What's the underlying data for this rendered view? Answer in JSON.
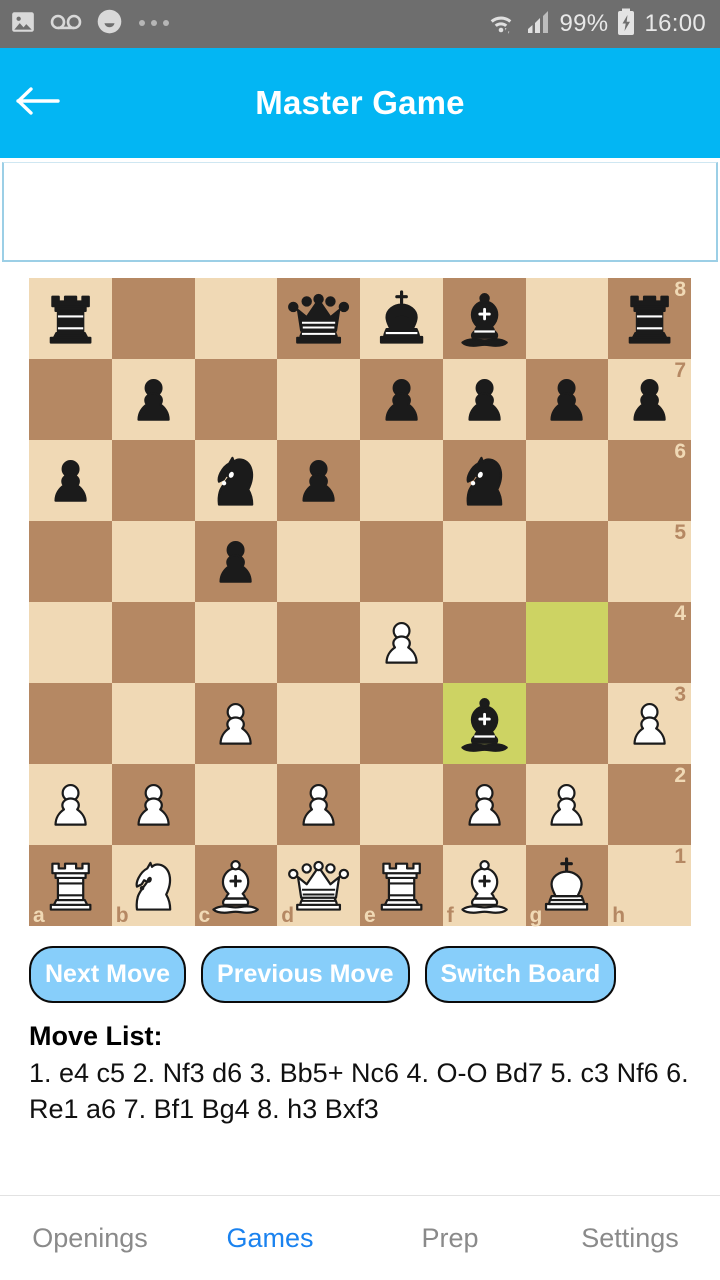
{
  "statusbar": {
    "left_icons": [
      "gallery-icon",
      "voicemail-icon",
      "smiley-icon",
      "more-dots-icon"
    ],
    "wifi_icon": "wifi-icon",
    "signal_icon": "cell-signal-icon",
    "battery_percent": "99%",
    "battery_icon": "battery-charging-icon",
    "clock": "16:00",
    "bg_color": "#6e6e6e"
  },
  "appbar": {
    "back_icon": "back-arrow-icon",
    "title": "Master Game",
    "bg_color": "#03b6f3"
  },
  "info_panel": {
    "text": ""
  },
  "board": {
    "light_color": "#f0d9b5",
    "dark_color": "#b58863",
    "highlight_color": "#cdd363",
    "files": [
      "a",
      "b",
      "c",
      "d",
      "e",
      "f",
      "g",
      "h"
    ],
    "ranks": [
      "8",
      "7",
      "6",
      "5",
      "4",
      "3",
      "2",
      "1"
    ],
    "highlighted_squares": [
      "g4",
      "f3"
    ],
    "orientation": "white",
    "position": [
      [
        "r",
        "",
        "",
        "q",
        "k",
        "b",
        "",
        "r"
      ],
      [
        "",
        "p",
        "",
        "",
        "p",
        "p",
        "p",
        "p"
      ],
      [
        "p",
        "",
        "n",
        "p",
        "",
        "n",
        "",
        ""
      ],
      [
        "",
        "",
        "p",
        "",
        "",
        "",
        "",
        ""
      ],
      [
        "",
        "",
        "",
        "",
        "P",
        "",
        "",
        ""
      ],
      [
        "",
        "",
        "P",
        "",
        "",
        "b",
        "",
        "P"
      ],
      [
        "P",
        "P",
        "",
        "P",
        "",
        "P",
        "P",
        ""
      ],
      [
        "R",
        "N",
        "B",
        "Q",
        "R",
        "B",
        "K",
        ""
      ]
    ]
  },
  "controls": {
    "next_move": "Next Move",
    "previous_move": "Previous Move",
    "switch_board": "Switch Board"
  },
  "movelist": {
    "title": "Move List:",
    "moves": "1. e4 c5 2. Nf3 d6 3. Bb5+ Nc6 4. O-O Bd7 5. c3 Nf6 6. Re1 a6 7. Bf1 Bg4 8. h3 Bxf3"
  },
  "bottomnav": {
    "active_color": "#1a82ef",
    "inactive_color": "#8a8a8a",
    "items": [
      {
        "label": "Openings",
        "active": false
      },
      {
        "label": "Games",
        "active": true
      },
      {
        "label": "Prep",
        "active": false
      },
      {
        "label": "Settings",
        "active": false
      }
    ]
  }
}
